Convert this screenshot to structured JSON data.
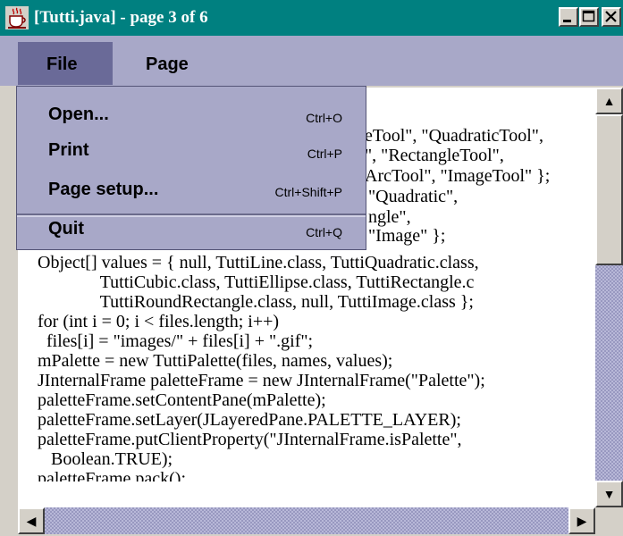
{
  "window": {
    "title": "[Tutti.java] - page 3 of 6",
    "icon": "java-coffee-cup-icon",
    "buttons": [
      "minimize-icon",
      "maximize-icon",
      "close-icon"
    ]
  },
  "menubar": {
    "items": [
      {
        "label": "File",
        "active": true
      },
      {
        "label": "Page",
        "active": false
      }
    ]
  },
  "file_menu": {
    "items": [
      {
        "label": "Open...",
        "shortcut": "Ctrl+O"
      },
      {
        "label": "Print",
        "shortcut": "Ctrl+P"
      },
      {
        "label": "Page setup...",
        "shortcut": "Ctrl+Shift+P"
      },
      {
        "label": "Quit",
        "shortcut": "Ctrl+Q"
      }
    ]
  },
  "document": {
    "partial_lines": [
      "eTool\", \"QuadraticTool\",",
      "\", \"RectangleTool\",",
      "ArcTool\", \"ImageTool\" };",
      "\"Quadratic\",",
      "ngle\",",
      "\"Image\" };"
    ],
    "lines": [
      "Object[] values = { null, TuttiLine.class, TuttiQuadratic.class,",
      "              TuttiCubic.class, TuttiEllipse.class, TuttiRectangle.c",
      "              TuttiRoundRectangle.class, null, TuttiImage.class };",
      "for (int i = 0; i < files.length; i++)",
      "  files[i] = \"images/\" + files[i] + \".gif\";",
      "mPalette = new TuttiPalette(files, names, values);",
      "JInternalFrame paletteFrame = new JInternalFrame(\"Palette\");",
      "paletteFrame.setContentPane(mPalette);",
      "paletteFrame.setLayer(JLayeredPane.PALETTE_LAYER);",
      "paletteFrame.putClientProperty(\"JInternalFrame.isPalette\",",
      "   Boolean.TRUE);",
      "paletteFrame.pack();"
    ]
  },
  "scrollbars": {
    "vertical_icons": [
      "arrow-up-icon",
      "arrow-down-icon"
    ],
    "horizontal_icons": [
      "arrow-left-icon",
      "arrow-right-icon"
    ],
    "up_glyph": "▲",
    "down_glyph": "▼",
    "left_glyph": "◀",
    "right_glyph": "▶"
  },
  "colors": {
    "titlebar": "#008080",
    "menubar": "#a8a8c8",
    "menu_active": "#6a6a98",
    "window_face": "#d4d0c8",
    "text_background": "#ffffff"
  }
}
